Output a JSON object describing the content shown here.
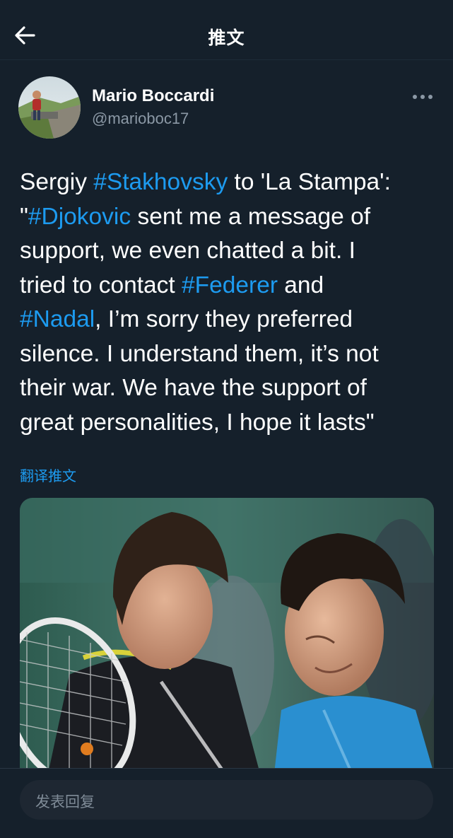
{
  "header": {
    "title": "推文"
  },
  "tweet": {
    "author": {
      "display_name": "Mario Boccardi",
      "handle": "@marioboc17"
    },
    "text_lines": [
      [
        {
          "t": "Sergiy "
        },
        {
          "t": "#Stakhovsky",
          "tag": true
        },
        {
          "t": " to 'La Stampa':"
        }
      ],
      [
        {
          "t": "\""
        },
        {
          "t": "#Djokovic",
          "tag": true
        },
        {
          "t": " sent me a message of"
        }
      ],
      [
        {
          "t": "support, we even chatted a bit. I"
        }
      ],
      [
        {
          "t": "tried to contact "
        },
        {
          "t": "#Federer",
          "tag": true
        },
        {
          "t": " and"
        }
      ],
      [
        {
          "t": "#Nadal",
          "tag": true
        },
        {
          "t": ", I’m sorry they preferred"
        }
      ],
      [
        {
          "t": "silence. I understand them, it’s not"
        }
      ],
      [
        {
          "t": "their war. We have the support of"
        }
      ],
      [
        {
          "t": "great personalities, I hope it lasts\""
        }
      ]
    ],
    "translate_label": "翻译推文"
  },
  "reply": {
    "placeholder": "发表回复"
  },
  "colors": {
    "background": "#15202b",
    "accent": "#1d9bf0",
    "secondary_text": "#8b98a5"
  },
  "icons": {
    "back": "arrow-left-icon",
    "more": "more-horizontal-icon"
  }
}
